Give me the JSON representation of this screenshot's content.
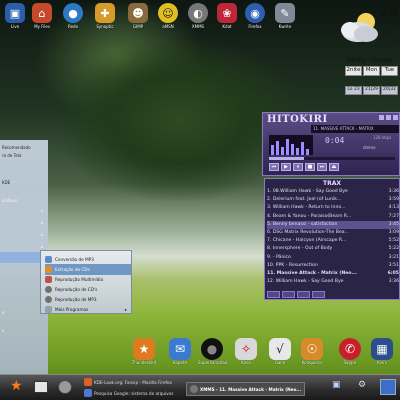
{
  "desktop_icons": [
    {
      "label": "Live",
      "color": "#2a5ea8",
      "glyph": "▣"
    },
    {
      "label": "My Files",
      "color": "#c44a2b",
      "glyph": "⌂"
    },
    {
      "label": "Rede",
      "color": "#2f78c4",
      "glyph": "●"
    },
    {
      "label": "Synaptic",
      "color": "#d89a2a",
      "glyph": "✚"
    },
    {
      "label": "GIMP",
      "color": "#8a6a3c",
      "glyph": "☻"
    },
    {
      "label": "aMSN",
      "color": "#e0c020",
      "glyph": "☺"
    },
    {
      "label": "XMMS",
      "color": "#777777",
      "glyph": "◐"
    },
    {
      "label": "Kdat",
      "color": "#c0263a",
      "glyph": "❀"
    },
    {
      "label": "Firefox",
      "color": "#2d5fb0",
      "glyph": "◉"
    },
    {
      "label": "Kwrite",
      "color": "#7f8a99",
      "glyph": "✎"
    }
  ],
  "weather": {
    "temp_partial": "26",
    "side_letters": [
      "P",
      "U",
      "R"
    ],
    "condition": "Partly cloudy",
    "days": [
      "2nite",
      "Mon",
      "Tue"
    ],
    "temps": [
      "Lo 23",
      "21|29",
      "20|32"
    ]
  },
  "start_menu": {
    "items": [
      "Recomendado",
      "ra de Tela",
      "KDE",
      "icativos"
    ],
    "lower_items": [
      "a",
      "s"
    ]
  },
  "multimedia_menu": {
    "items": [
      {
        "label": "Conversão de MP3",
        "color": "#5a88c8"
      },
      {
        "label": "Extração de CDs",
        "color": "#e08a2a"
      },
      {
        "label": "Reprodução Multimídia",
        "color": "#c04a4a"
      },
      {
        "label": "Reprodução de CD's",
        "color": "#6f6f6f"
      },
      {
        "label": "Reprodução de MP3",
        "color": "#6f6f6f"
      },
      {
        "label": "Mais Programas",
        "color": "#8fa0b2"
      }
    ],
    "selected_index": 1
  },
  "player": {
    "skin_title": "HITOKIRI",
    "marquee": "11. MASSIVE ATTACK - MATRIX",
    "time": "0:04",
    "kbps": "128 kbps",
    "eq": "stereo",
    "seek_fraction": 0.28,
    "controls": [
      "⏮",
      "▶",
      "⏸",
      "■",
      "⏭",
      "⏏"
    ]
  },
  "playlist": {
    "title": "TRAX",
    "rows": [
      {
        "text": "1. 08.William Hawk - Say Good Bye",
        "dur": "3:36"
      },
      {
        "text": "2. Delerium feat. Joel (of Lunik...",
        "dur": "3:59"
      },
      {
        "text": "3. William Hawk - Return to Inno...",
        "dur": "4:13"
      },
      {
        "text": "4. Beam & Yanou - Paraiso(Beam R...",
        "dur": "7:27"
      },
      {
        "text": "5. Benny benassi - satisfaction",
        "dur": "3:45"
      },
      {
        "text": "6. DSG Matrix Revolution-The Bea...",
        "dur": "3:09"
      },
      {
        "text": "7. Chicane - Halcyon (Airscape R...",
        "dur": "5:52"
      },
      {
        "text": "8. Innersphere - Out of Body",
        "dur": "5:22"
      },
      {
        "text": "9. - Pânico",
        "dur": "3:21"
      },
      {
        "text": "10. PPK - Resurrection",
        "dur": "3:51"
      },
      {
        "text": "11. Massive Attack - Matrix (Neo...",
        "dur": "6:05"
      },
      {
        "text": "12. William Hawk - Say Good Bye",
        "dur": "3:36"
      }
    ],
    "selected_index": 4,
    "bold_index": 10
  },
  "dock": [
    {
      "label": "Thunderbird",
      "color": "#e07a1f",
      "glyph": "★"
    },
    {
      "label": "Kopete",
      "color": "#3a7ad0",
      "glyph": "✉"
    },
    {
      "label": "Superkaramba",
      "color": "#111111",
      "glyph": "●"
    },
    {
      "label": "Kasa",
      "color": "#d8d8d8",
      "glyph": "✧"
    },
    {
      "label": "Gaim",
      "color": "#e8e8e8",
      "glyph": "√"
    },
    {
      "label": "Konqueror",
      "color": "#d88b2a",
      "glyph": "☉"
    },
    {
      "label": "Skype",
      "color": "#c8202a",
      "glyph": "✆"
    },
    {
      "label": "Kvirc",
      "color": "#2b4f8a",
      "glyph": "▦"
    }
  ],
  "taskbar": {
    "start_glyph": "★",
    "tasks": [
      {
        "label": "KDE-Look.org: Fansip - Mozilla Firefox",
        "color": "#d9622b"
      },
      {
        "label": "Pesquisa Google: sistema de arquivos",
        "color": "#4c7ad0"
      }
    ],
    "active_task": "XMMS - 11. Massive Attack - Matrix (Neo...",
    "system_tray": [
      "▣",
      "⚙"
    ]
  }
}
